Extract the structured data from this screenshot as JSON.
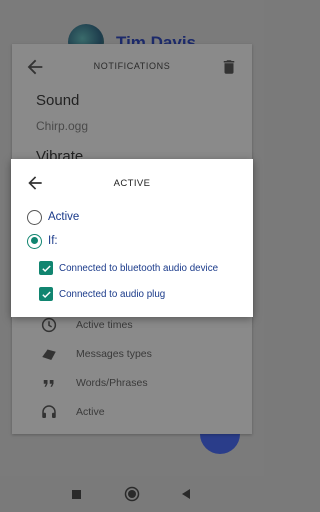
{
  "background": {
    "user_name": "Tim Davis"
  },
  "notifications_sheet": {
    "title": "NOTIFICATIONS",
    "sound_label": "Sound",
    "sound_value": "Chirp.ogg",
    "vibrate_label": "Vibrate",
    "options": [
      {
        "label": "Active times",
        "icon": "clock-icon"
      },
      {
        "label": "Messages types",
        "icon": "message-types-icon"
      },
      {
        "label": "Words/Phrases",
        "icon": "quote-icon"
      },
      {
        "label": "Active",
        "icon": "headphones-icon"
      }
    ]
  },
  "dialog": {
    "title": "ACTIVE",
    "radio_options": [
      {
        "label": "Active",
        "checked": false
      },
      {
        "label": "If:",
        "checked": true
      }
    ],
    "conditions": [
      {
        "label": "Connected to bluetooth audio device",
        "checked": true
      },
      {
        "label": "Connected to audio plug",
        "checked": true
      }
    ]
  },
  "navigation": {
    "buttons": [
      "recents-icon",
      "home-icon",
      "back-icon"
    ]
  },
  "colors": {
    "accent": "#118570",
    "link_text": "#1a3a8a",
    "scrim": "#7a7a7a"
  }
}
